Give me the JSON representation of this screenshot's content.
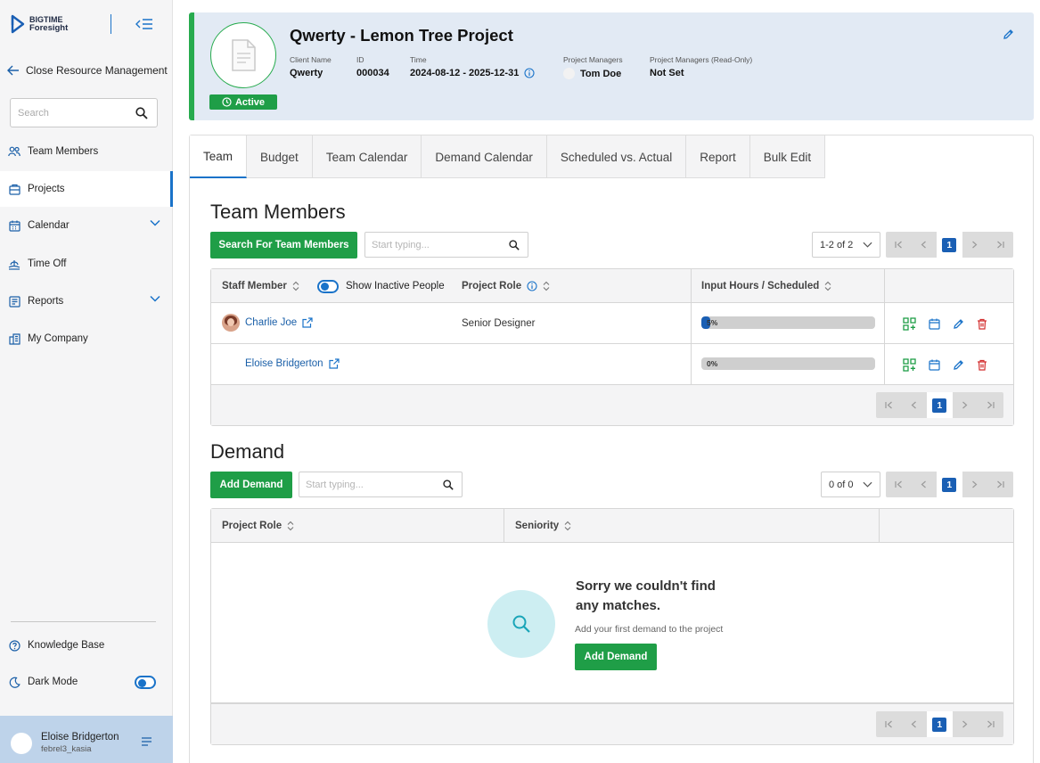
{
  "brand": {
    "line1": "BIGTIME",
    "line2": "Foresight"
  },
  "sidebar": {
    "back_label": "Close Resource Management",
    "search_placeholder": "Search",
    "items": [
      {
        "label": "Team Members",
        "icon": "team-icon"
      },
      {
        "label": "Projects",
        "icon": "projects-icon",
        "active": true
      },
      {
        "label": "Calendar",
        "icon": "calendar-icon",
        "expandable": true
      },
      {
        "label": "Time Off",
        "icon": "time-off-icon"
      },
      {
        "label": "Reports",
        "icon": "reports-icon",
        "expandable": true
      },
      {
        "label": "My Company",
        "icon": "company-icon"
      }
    ],
    "knowledge_base": "Knowledge Base",
    "dark_mode": "Dark Mode",
    "user": {
      "name": "Eloise Bridgerton",
      "id": "febrel3_kasia"
    }
  },
  "project": {
    "title": "Qwerty - Lemon Tree Project",
    "status": "Active",
    "client_label": "Client Name",
    "client_value": "Qwerty",
    "id_label": "ID",
    "id_value": "000034",
    "time_label": "Time",
    "time_value": "2024-08-12 - 2025-12-31",
    "pm_label": "Project Managers",
    "pm_value": "Tom Doe",
    "pm_ro_label": "Project Managers (Read-Only)",
    "pm_ro_value": "Not Set"
  },
  "tabs": [
    "Team",
    "Budget",
    "Team Calendar",
    "Demand Calendar",
    "Scheduled vs. Actual",
    "Report",
    "Bulk Edit"
  ],
  "team": {
    "title": "Team Members",
    "search_button": "Search For Team Members",
    "search_placeholder": "Start typing...",
    "page_range": "1-2 of 2",
    "page": "1",
    "columns": {
      "staff": "Staff Member",
      "show_inactive": "Show Inactive People",
      "role": "Project Role",
      "hours": "Input Hours / Scheduled"
    },
    "rows": [
      {
        "name": "Charlie Joe",
        "role": "Senior Designer",
        "progress_label": "5%",
        "progress": 0.05
      },
      {
        "name": "Eloise Bridgerton",
        "role": "",
        "progress_label": "0%",
        "progress": 0
      }
    ]
  },
  "demand": {
    "title": "Demand",
    "add_button": "Add Demand",
    "search_placeholder": "Start typing...",
    "page_range": "0 of 0",
    "page": "1",
    "columns": {
      "role": "Project Role",
      "seniority": "Seniority"
    },
    "empty_title_1": "Sorry we couldn't find",
    "empty_title_2": "any matches.",
    "empty_sub": "Add your first demand to the project",
    "empty_button": "Add Demand"
  },
  "colors": {
    "accent": "#1a73c9",
    "green": "#1f9e47",
    "header_bg": "#e2eaf4",
    "danger": "#d32f2f"
  }
}
